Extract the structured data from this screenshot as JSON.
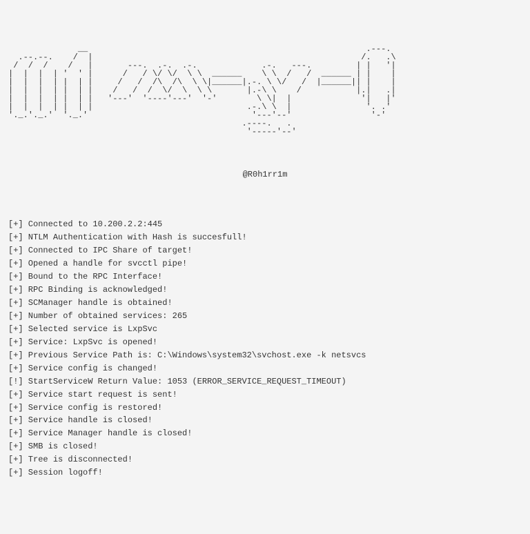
{
  "ascii_art": "              __                                                        .---.\n  .--.--.    /  |                                                      /.   .\\\n /  /  /    /   |       ---.  .-.  .-.             .-.   ---.         | |   '|\n|  |  |  | '  ' |      /   / \\/ \\/  \\ \\  ______    \\ \\  /   /  ______ | |    |\n|  |  |  | |  | |     /   /  /\\  /\\  \\ \\|______|.-. \\ \\/   /  |______|| |    |\n|  |  |  | |  | |    /   /  /  \\/  \\  \\ \\       |.-\\ \\    /           |.|   .|\n|  |  |  | |  | |   '---'  '----'---'  '-'        \\ \\|  |              '|   |'\n|  |  |  | |  | |                               .-.\\ \\  |               '. .'\n'._.'._.'  '._.'                                 '---'--'                '-'\n                                               .----.   .\n                                                '-----'--'",
  "handle": "@R0h1rr1m",
  "log_lines": [
    {
      "prefix": "[+]",
      "text": "Connected to 10.200.2.2:445"
    },
    {
      "prefix": "[+]",
      "text": "NTLM Authentication with Hash is succesfull!"
    },
    {
      "prefix": "[+]",
      "text": "Connected to IPC Share of target!"
    },
    {
      "prefix": "[+]",
      "text": "Opened a handle for svcctl pipe!"
    },
    {
      "prefix": "[+]",
      "text": "Bound to the RPC Interface!"
    },
    {
      "prefix": "[+]",
      "text": "RPC Binding is acknowledged!"
    },
    {
      "prefix": "[+]",
      "text": "SCManager handle is obtained!"
    },
    {
      "prefix": "[+]",
      "text": "Number of obtained services: 265"
    },
    {
      "prefix": "[+]",
      "text": "Selected service is LxpSvc"
    },
    {
      "prefix": "[+]",
      "text": "Service: LxpSvc is opened!"
    },
    {
      "prefix": "[+]",
      "text": "Previous Service Path is: C:\\Windows\\system32\\svchost.exe -k netsvcs"
    },
    {
      "prefix": "[+]",
      "text": "Service config is changed!"
    },
    {
      "prefix": "[!]",
      "text": "StartServiceW Return Value: 1053 (ERROR_SERVICE_REQUEST_TIMEOUT)"
    },
    {
      "prefix": "[+]",
      "text": "Service start request is sent!"
    },
    {
      "prefix": "[+]",
      "text": "Service config is restored!"
    },
    {
      "prefix": "[+]",
      "text": "Service handle is closed!"
    },
    {
      "prefix": "[+]",
      "text": "Service Manager handle is closed!"
    },
    {
      "prefix": "[+]",
      "text": "SMB is closed!"
    },
    {
      "prefix": "[+]",
      "text": "Tree is disconnected!"
    },
    {
      "prefix": "[+]",
      "text": "Session logoff!"
    }
  ]
}
